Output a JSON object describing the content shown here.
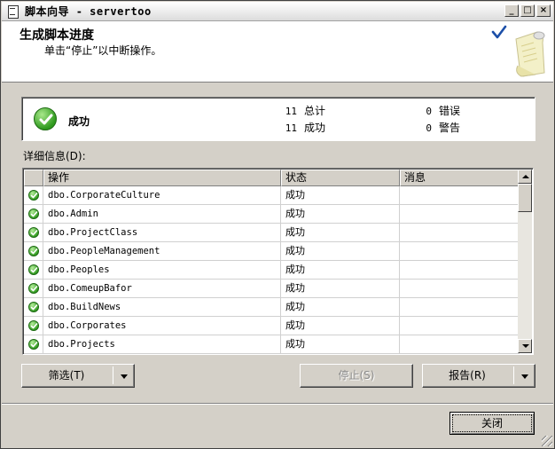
{
  "window": {
    "title": "脚本向导 - servertoo",
    "controls": {
      "minimize": "_",
      "maximize": "□",
      "close": "×"
    }
  },
  "header": {
    "title": "生成脚本进度",
    "subtitle": "单击“停止”以中断操作。",
    "art_icon": "checkmark-scroll-art"
  },
  "summary": {
    "status": "成功",
    "status_icon": "success-check-icon",
    "total_count": "11",
    "total_label": "总计",
    "success_count": "11",
    "success_label": "成功",
    "error_count": "0",
    "error_label": "错误",
    "warning_count": "0",
    "warning_label": "警告"
  },
  "details": {
    "label": "详细信息(D):",
    "columns": {
      "action": "操作",
      "status": "状态",
      "message": "消息"
    },
    "rows": [
      {
        "action": "dbo.CorporateCulture",
        "status": "成功",
        "message": ""
      },
      {
        "action": "dbo.Admin",
        "status": "成功",
        "message": ""
      },
      {
        "action": "dbo.ProjectClass",
        "status": "成功",
        "message": ""
      },
      {
        "action": "dbo.PeopleManagement",
        "status": "成功",
        "message": ""
      },
      {
        "action": "dbo.Peoples",
        "status": "成功",
        "message": ""
      },
      {
        "action": "dbo.ComeupBafor",
        "status": "成功",
        "message": ""
      },
      {
        "action": "dbo.BuildNews",
        "status": "成功",
        "message": ""
      },
      {
        "action": "dbo.Corporates",
        "status": "成功",
        "message": ""
      },
      {
        "action": "dbo.Projects",
        "status": "成功",
        "message": ""
      }
    ]
  },
  "buttons": {
    "filter": "筛选(T)",
    "stop": "停止(S)",
    "report": "报告(R)",
    "close": "关闭"
  },
  "colors": {
    "success_green": "#2f9a1e",
    "dialog_gray": "#d4d0c8"
  }
}
